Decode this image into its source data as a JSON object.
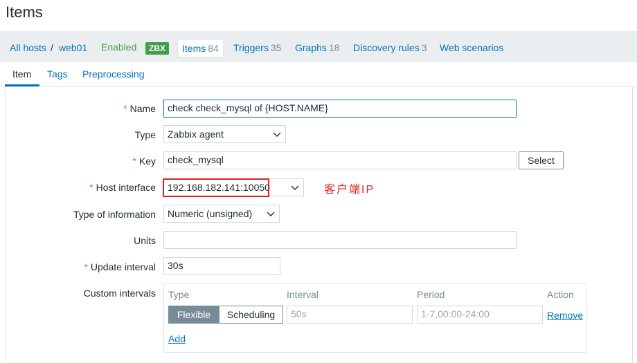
{
  "page": {
    "title": "Items"
  },
  "nav": {
    "all_hosts": "All hosts",
    "separator": "/",
    "host": "web01",
    "status": "Enabled",
    "zbx": "ZBX",
    "items_label": "Items",
    "items_count": "84",
    "triggers_label": "Triggers",
    "triggers_count": "35",
    "graphs_label": "Graphs",
    "graphs_count": "18",
    "discovery_label": "Discovery rules",
    "discovery_count": "3",
    "web_label": "Web scenarios"
  },
  "tabs": [
    {
      "label": "Item"
    },
    {
      "label": "Tags"
    },
    {
      "label": "Preprocessing"
    }
  ],
  "form": {
    "required_mark": "*",
    "name_label": "Name",
    "name_value": "check check_mysql of {HOST.NAME}",
    "type_label": "Type",
    "type_value": "Zabbix agent",
    "key_label": "Key",
    "key_value": "check_mysql",
    "select_button": "Select",
    "host_interface_label": "Host interface",
    "host_interface_value": "192.168.182.141:10050",
    "type_info_label": "Type of information",
    "type_info_value": "Numeric (unsigned)",
    "units_label": "Units",
    "units_value": "",
    "update_interval_label": "Update interval",
    "update_interval_value": "30s",
    "custom_intervals_label": "Custom intervals"
  },
  "custom_intervals": {
    "col_type": "Type",
    "col_interval": "Interval",
    "col_period": "Period",
    "col_action": "Action",
    "flexible": "Flexible",
    "scheduling": "Scheduling",
    "interval_placeholder": "50s",
    "period_placeholder": "1-7,00:00-24:00",
    "remove": "Remove",
    "add": "Add"
  },
  "annotation": {
    "text": "客户端IP",
    "color": "#e02020"
  },
  "colors": {
    "link": "#0275b8",
    "enabled": "#429e47",
    "required": "#e45959"
  }
}
